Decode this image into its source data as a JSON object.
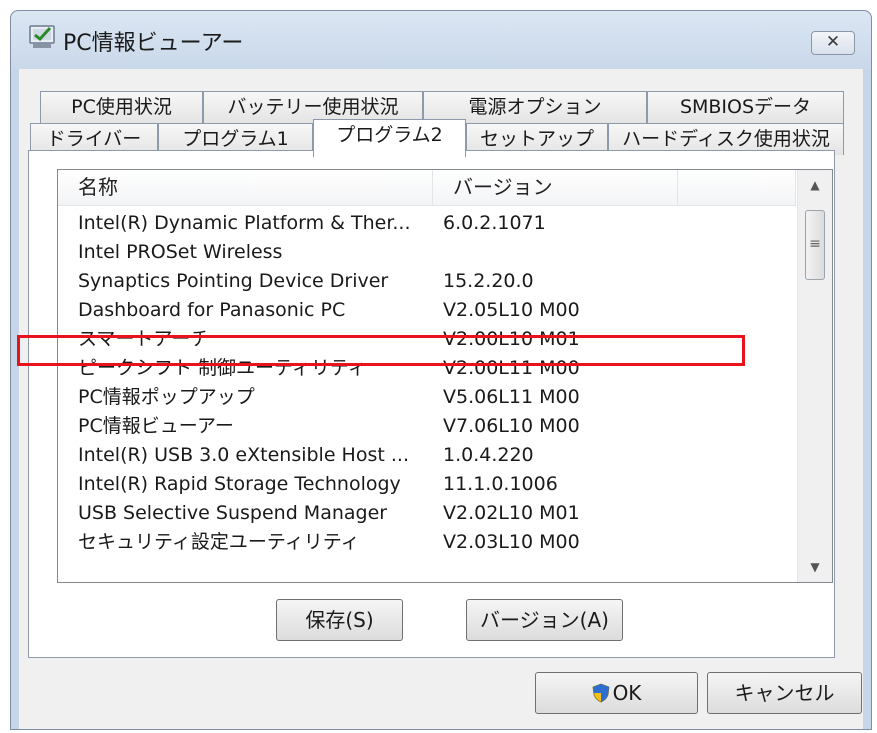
{
  "window": {
    "title": "PC情報ビューアー",
    "close_symbol": "✕"
  },
  "tabs_row1": [
    {
      "label": "PC使用状況"
    },
    {
      "label": "バッテリー使用状況"
    },
    {
      "label": "電源オプション"
    },
    {
      "label": "SMBIOSデータ"
    }
  ],
  "tabs_row2": [
    {
      "label": "ドライバー"
    },
    {
      "label": "プログラム1"
    },
    {
      "label": "プログラム2"
    },
    {
      "label": "セットアップ"
    },
    {
      "label": "ハードディスク使用状況"
    }
  ],
  "active_tab": "プログラム2",
  "list": {
    "columns": [
      "名称",
      "バージョン"
    ],
    "rows": [
      {
        "name": "Intel(R) Dynamic Platform & Ther...",
        "version": "6.0.2.1071"
      },
      {
        "name": "Intel PROSet Wireless",
        "version": ""
      },
      {
        "name": "Synaptics Pointing Device Driver",
        "version": "15.2.20.0"
      },
      {
        "name": "Dashboard for Panasonic PC",
        "version": "V2.05L10 M00"
      },
      {
        "name": "スマートアーチ",
        "version": "V2.00L10 M01"
      },
      {
        "name": "ピークシフト 制御ユーティリティ",
        "version": "V2.00L11 M00"
      },
      {
        "name": "PC情報ポップアップ",
        "version": "V5.06L11 M00"
      },
      {
        "name": "PC情報ビューアー",
        "version": "V7.06L10 M00"
      },
      {
        "name": "Intel(R) USB 3.0 eXtensible Host ...",
        "version": "1.0.4.220"
      },
      {
        "name": "Intel(R) Rapid Storage Technology",
        "version": "11.1.0.1006"
      },
      {
        "name": "USB Selective Suspend Manager",
        "version": "V2.02L10 M01"
      },
      {
        "name": "セキュリティ設定ユーティリティ",
        "version": "V2.03L10 M00"
      }
    ],
    "highlighted_row": "スマートアーチ",
    "highlight_color": "#e8131b"
  },
  "buttons": {
    "save": "保存(S)",
    "version": "バージョン(A)",
    "ok": "OK",
    "cancel": "キャンセル"
  },
  "icons": {
    "app": "pc-viewer-icon",
    "ok_shield": "uac-shield-icon",
    "scroll_up": "▲",
    "scroll_down": "▼",
    "thumb_grip": "≡"
  }
}
